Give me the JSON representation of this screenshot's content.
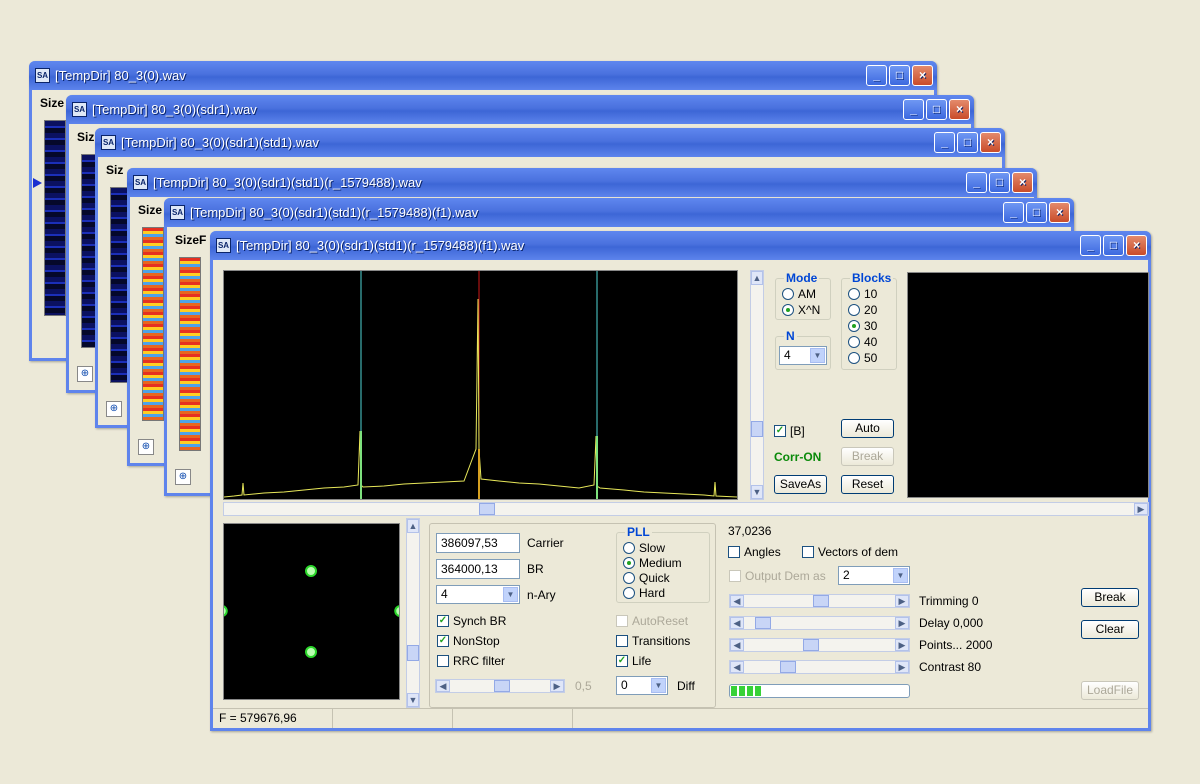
{
  "background_windows": [
    {
      "title": "[TempDir] 80_3(0).wav",
      "label": "Size"
    },
    {
      "title": "[TempDir] 80_3(0)(sdr1).wav",
      "label": "Siz"
    },
    {
      "title": "[TempDir] 80_3(0)(sdr1)(std1).wav",
      "label": "Siz"
    },
    {
      "title": "[TempDir] 80_3(0)(sdr1)(std1)(r_1579488).wav",
      "label": "Size"
    },
    {
      "title": "[TempDir] 80_3(0)(sdr1)(std1)(r_1579488)(f1).wav",
      "label": "SizeF"
    }
  ],
  "main_window": {
    "title": "[TempDir] 80_3(0)(sdr1)(std1)(r_1579488)(f1).wav",
    "icon": "app-logo-icon"
  },
  "mode": {
    "title": "Mode",
    "options": [
      "AM",
      "X^N"
    ],
    "selected": "X^N"
  },
  "n_group": {
    "title": "N",
    "value": "4"
  },
  "blocks": {
    "title": "Blocks",
    "options": [
      "10",
      "20",
      "30",
      "40",
      "50"
    ],
    "selected": "30"
  },
  "b_checkbox": {
    "label": "[B]",
    "checked": true
  },
  "corr_status": "Corr-ON",
  "buttons": {
    "auto": "Auto",
    "break_top": "Break",
    "saveas": "SaveAs",
    "reset": "Reset",
    "break": "Break",
    "clear": "Clear",
    "loadfile": "LoadFile"
  },
  "params": {
    "carrier_value": "386097,53",
    "carrier_label": "Carrier",
    "br_value": "364000,13",
    "br_label": "BR",
    "nary_value": "4",
    "nary_label": "n-Ary",
    "slider_value": "0,5"
  },
  "checks": {
    "synch_br": "Synch BR",
    "nonstop": "NonStop",
    "rrc_filter": "RRC filter",
    "autoreset": "AutoReset",
    "transitions": "Transitions",
    "life": "Life",
    "angles": "Angles",
    "vectors": "Vectors of dem",
    "output_dem": "Output Dem as"
  },
  "pll": {
    "title": "PLL",
    "options": [
      "Slow",
      "Medium",
      "Quick",
      "Hard"
    ],
    "selected": "Medium"
  },
  "diff": {
    "value": "0",
    "label": "Diff"
  },
  "readout": "37,0236",
  "output_dem_value": "2",
  "sliders": [
    {
      "label": "Trimming 0",
      "position": 0.5
    },
    {
      "label": "Delay  0,000",
      "position": 0.08
    },
    {
      "label": "Points... 2000",
      "position": 0.43
    },
    {
      "label": "Contrast 80",
      "position": 0.26
    }
  ],
  "progress_fraction": 0.18,
  "status": {
    "frequency": "F = 579676,96"
  },
  "colors": {
    "title_blue": "#3d66d6",
    "accent_green": "#21a121",
    "corr_green": "#0a8a0a",
    "spectrum_trace": "#e8e85a",
    "marker_cyan": "#4fd6d6",
    "marker_red": "#d01818"
  },
  "constellation_points": [
    {
      "i": 0.0,
      "q": 0.8
    },
    {
      "i": -0.85,
      "q": 0.0
    },
    {
      "i": 0.85,
      "q": 0.0
    },
    {
      "i": 0.0,
      "q": -0.82
    }
  ]
}
